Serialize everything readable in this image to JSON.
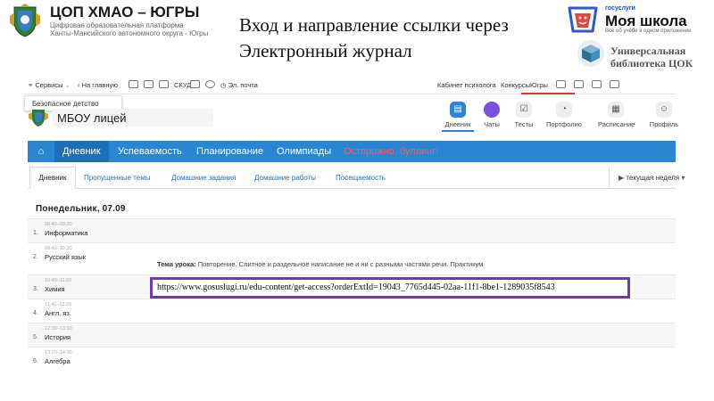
{
  "slide": {
    "title": "Вход и направление  ссылки через Электронный журнал"
  },
  "org_logo": {
    "title": "ЦОП ХМАО – ЮГРЫ",
    "line2": "Цифровая образовательная платформа",
    "line3": "Ханты-Мансийского автономного округа - Югры"
  },
  "moya_shkola": {
    "gos": "госуслуги",
    "name": "Моя школа",
    "tagline": "Всё об учёбе в одном приложении"
  },
  "library": {
    "title_line1": "Универсальная",
    "title_line2": "библиотека ЦОК"
  },
  "topbar": {
    "services": "Сервисы",
    "home": "На главную",
    "skud": "СКУД",
    "email": "Эл. почта",
    "psychologist": "Кабинет психолога",
    "contests": "КонкурсыЮгры"
  },
  "tooltip": "Безопасное детство",
  "school": {
    "name": "МБОУ лицей"
  },
  "nav": [
    "Дневник",
    "Чаты",
    "Тесты",
    "Портфолио",
    "Расписание",
    "Профиль"
  ],
  "menu": [
    "Дневник",
    "Успеваемость",
    "Планирование",
    "Олимпиады",
    "Осторожно, буллинг!"
  ],
  "subtabs": [
    "Дневник",
    "Пропущенные темы",
    "Домашние задания",
    "Домашние работы",
    "Посещаемость"
  ],
  "week_nav": "текущая неделя",
  "day": "Понедельник, 07.09",
  "lessons": [
    {
      "num": "1.",
      "time": "08:40–09:20",
      "name": "Информатика"
    },
    {
      "num": "2.",
      "time": "09:40–10:20",
      "name": "Русский язык"
    },
    {
      "num": "3.",
      "time": "10:40–11:20",
      "name": "Химия"
    },
    {
      "num": "4.",
      "time": "11:40–12:20",
      "name": "Англ. яз."
    },
    {
      "num": "5.",
      "time": "12:30–13:10",
      "name": "История"
    },
    {
      "num": "6.",
      "time": "13:20–14:00",
      "name": "Алгебра"
    }
  ],
  "topic": {
    "label": "Тема урока:",
    "text": "Повторение. Слитное и раздельное написание не и ни с разными частями речи. Практикум"
  },
  "access_url": "https://www.gosuslugi.ru/edu-content/get-access?orderExtId=19043_7765d445-02aa-11f1-8be1-1289035f8543",
  "colors": {
    "primary_blue": "#2a85d4",
    "active_menu": "#1d6fb8",
    "warning": "#ff5a5f",
    "highlight_border": "#6b3fa0"
  }
}
